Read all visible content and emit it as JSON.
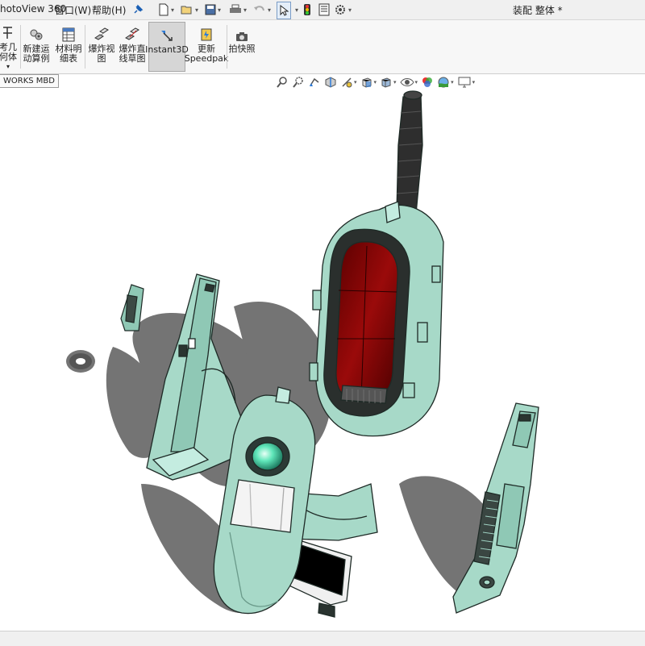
{
  "menubar": {
    "photoview": "hotoView 360",
    "window": "窗口(W)",
    "help": "帮助(H)",
    "doc_title": "装配 整体 *"
  },
  "ribbon": {
    "partial_label_1": "考几",
    "partial_label_2": "何体",
    "new_motion_study": [
      "新建运",
      "动算例"
    ],
    "bom": [
      "材料明",
      "细表"
    ],
    "exploded_view": [
      "爆炸视",
      "图"
    ],
    "explode_line_sketch": [
      "爆炸直",
      "线草图"
    ],
    "instant3d": "Instant3D",
    "update_speedpak": [
      "更新",
      "Speedpak"
    ],
    "snapshot": "拍快照"
  },
  "tabs": {
    "mbd": "WORKS MBD"
  },
  "colors": {
    "part_body": "#a8d8c8",
    "part_shadow": "#6b6b6b",
    "cavity": "#7a0000",
    "handle": "#2e2e2e",
    "lens": "#4fe0b0"
  }
}
